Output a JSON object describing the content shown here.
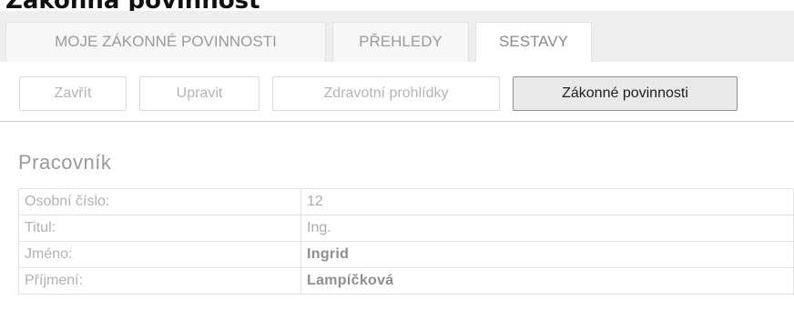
{
  "page": {
    "title": "Zákonná povinnost"
  },
  "tabs": [
    {
      "label": "MOJE ZÁKONNÉ POVINNOSTI",
      "active": false
    },
    {
      "label": "PŘEHLEDY",
      "active": false
    },
    {
      "label": "SESTAVY",
      "active": true
    }
  ],
  "toolbar": {
    "buttons": [
      {
        "label": "Zavřít",
        "enabled": false
      },
      {
        "label": "Upravit",
        "enabled": false
      },
      {
        "label": "Zdravotní prohlídky",
        "enabled": false
      },
      {
        "label": "Zákonné povinnosti",
        "enabled": true
      }
    ]
  },
  "section": {
    "heading": "Pracovník"
  },
  "employee": {
    "rows": [
      {
        "label": "Osobní číslo:",
        "value": "12"
      },
      {
        "label": "Titul:",
        "value": "Ing."
      },
      {
        "label": "Jméno:",
        "value": "Ingrid"
      },
      {
        "label": "Příjmení:",
        "value": "Lampíčková"
      }
    ]
  },
  "colors": {
    "tabbar_bg": "#eeeeee",
    "muted_text": "#b4b4b4",
    "primary_button_bg": "#e9e9e9",
    "primary_button_border": "#8f8f8f"
  }
}
